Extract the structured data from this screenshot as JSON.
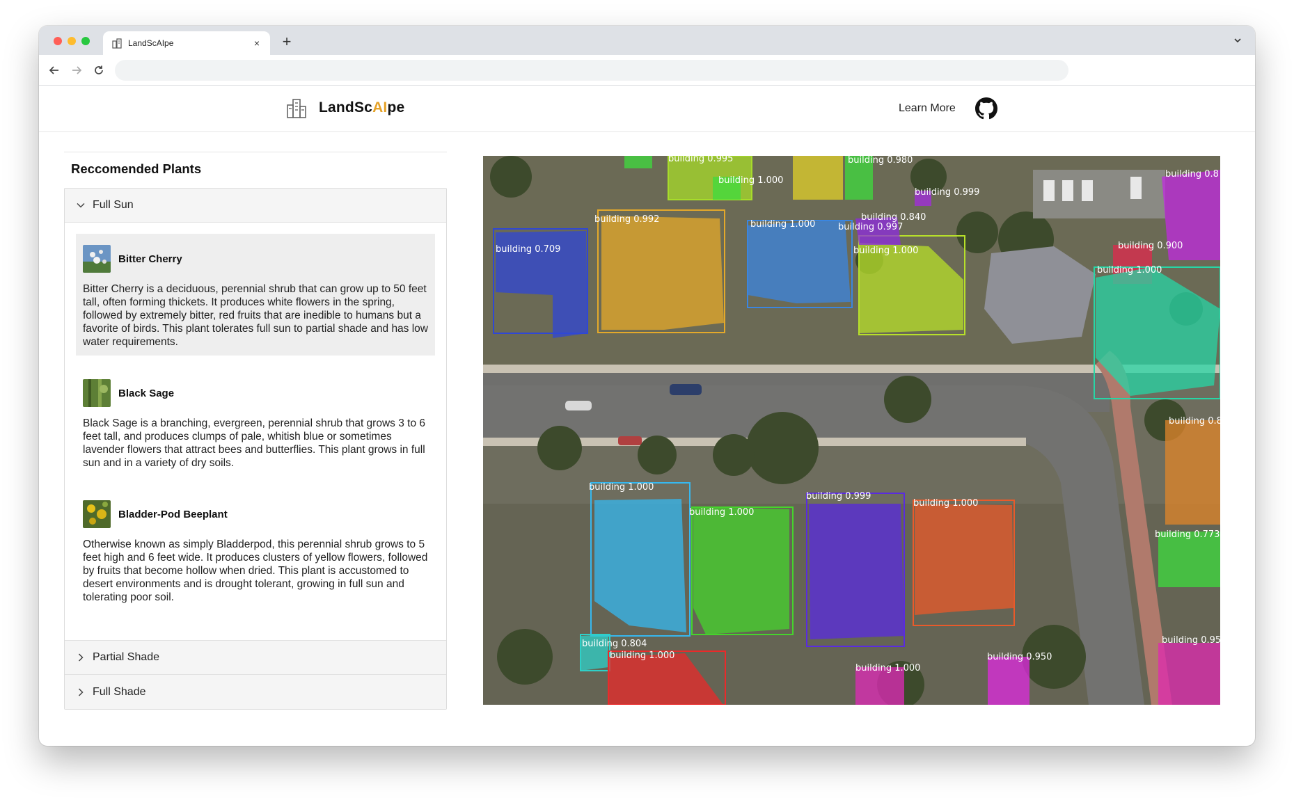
{
  "browser": {
    "tab_title": "LandScAIpe",
    "new_tab_label": "+",
    "close_label": "×"
  },
  "header": {
    "brand_prefix": "LandSc",
    "brand_ai": "AI",
    "brand_suffix": "pe",
    "learn_more": "Learn More"
  },
  "panel": {
    "title": "Reccomended Plants",
    "sections": [
      {
        "label": "Full Sun",
        "expanded": true
      },
      {
        "label": "Partial Shade",
        "expanded": false
      },
      {
        "label": "Full Shade",
        "expanded": false
      }
    ],
    "plants": [
      {
        "name": "Bitter Cherry",
        "selected": true,
        "description": "Bitter Cherry is a deciduous, perennial shrub that can grow up to 50 feet tall, often forming thickets. It produces white flowers in the spring, followed by extremely bitter, red fruits that are inedible to humans but a favorite of birds. This plant tolerates full sun to partial shade and has low water requirements."
      },
      {
        "name": "Black Sage",
        "selected": false,
        "description": "Black Sage is a branching, evergreen, perennial shrub that grows 3 to 6 feet tall, and produces clumps of pale, whitish blue or sometimes lavender flowers that attract bees and butterflies. This plant grows in full sun and in a variety of dry soils."
      },
      {
        "name": "Bladder-Pod Beeplant",
        "selected": false,
        "description": "Otherwise known as simply Bladderpod, this perennial shrub grows to 5 feet high and 6 feet wide. It produces clusters of yellow flowers, followed by fruits that become hollow when dried. This plant is accustomed to desert environments and is drought tolerant, growing in full sun and tolerating poor soil."
      }
    ]
  },
  "detections": [
    {
      "label": "building 0.709",
      "color": "#2f47d6"
    },
    {
      "label": "building 0.992",
      "color": "#e4a92a"
    },
    {
      "label": "building 1.000",
      "color": "#3b86e0"
    },
    {
      "label": "building 1.000",
      "color": "#b7e02a"
    },
    {
      "label": "building 0.997",
      "color": "#2f47d6"
    },
    {
      "label": "building 0.840",
      "color": "#8e2be0"
    },
    {
      "label": "building 0.999",
      "color": "#a32be0"
    },
    {
      "label": "building 0.995",
      "color": "#a7dc2a"
    },
    {
      "label": "building 1.000",
      "color": "#3edc3e"
    },
    {
      "label": "building 0.980",
      "color": "#3edc3e"
    },
    {
      "label": "building 0.900",
      "color": "#e02a4d"
    },
    {
      "label": "building 1.000",
      "color": "#27d6a6"
    },
    {
      "label": "building 0.804",
      "color": "#2fd0c8"
    },
    {
      "label": "building 1.000",
      "color": "#36b8f0"
    },
    {
      "label": "building 1.000",
      "color": "#45d42c"
    },
    {
      "label": "building 0.999",
      "color": "#5a2be0"
    },
    {
      "label": "building 1.000",
      "color": "#ea5a2a"
    },
    {
      "label": "building 1.000",
      "color": "#ea2a2a"
    },
    {
      "label": "building 1.000",
      "color": "#e02ab8"
    },
    {
      "label": "building 0.950",
      "color": "#e02ae0"
    },
    {
      "label": "building 0.95",
      "color": "#e02ab0"
    },
    {
      "label": "building 0.773",
      "color": "#3edc3e"
    },
    {
      "label": "building 0.8",
      "color": "#e0862a"
    },
    {
      "label": "building 0.8",
      "color": "#c02ae0"
    }
  ]
}
